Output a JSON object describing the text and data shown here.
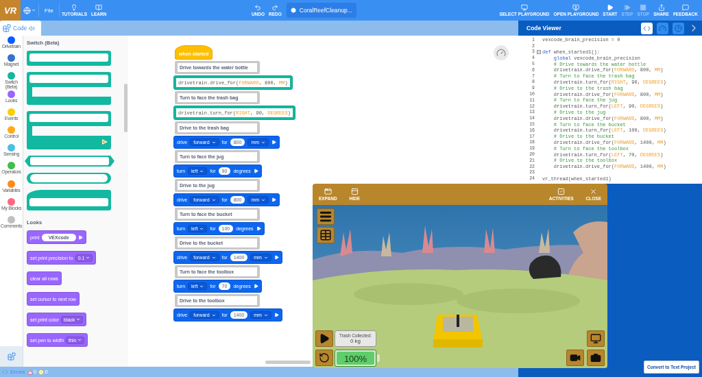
{
  "top_bar": {
    "logo": "VR",
    "menus": [
      {
        "label": "File"
      }
    ],
    "tools": [
      {
        "label": "TUTORIALS"
      },
      {
        "label": "LEARN"
      }
    ],
    "history": [
      {
        "label": "UNDO"
      },
      {
        "label": "REDO"
      }
    ],
    "project": "CoralReefCleanup...",
    "actions": [
      {
        "label": "SELECT PLAYGROUND",
        "disabled": false
      },
      {
        "label": "OPEN PLAYGROUND",
        "disabled": false
      },
      {
        "label": "START",
        "disabled": false
      },
      {
        "label": "STEP",
        "disabled": true
      },
      {
        "label": "STOP",
        "disabled": true
      },
      {
        "label": "SHARE",
        "disabled": false
      },
      {
        "label": "FEEDBACK",
        "disabled": false
      }
    ]
  },
  "code_tab": {
    "label": "Code",
    "selected": true
  },
  "categories": [
    {
      "label": "Drivetrain",
      "color": "#0a5cff"
    },
    {
      "label": "Magnet",
      "color": "#3373cc"
    },
    {
      "label": "Switch (Beta)",
      "color": "#13b8a0"
    },
    {
      "label": "Looks",
      "color": "#9966ff"
    },
    {
      "label": "Events",
      "color": "#ffcc00"
    },
    {
      "label": "Control",
      "color": "#ffab19"
    },
    {
      "label": "Sensing",
      "color": "#4cbfe6"
    },
    {
      "label": "Operators",
      "color": "#40bf4a"
    },
    {
      "label": "Variables",
      "color": "#ff8c1a"
    },
    {
      "label": "My Blocks",
      "color": "#ff6680"
    },
    {
      "label": "Comments",
      "color": "#c0c0c0"
    }
  ],
  "palette": {
    "sections": [
      {
        "title": "Switch (Beta)",
        "blocks": [
          {
            "kind": "stack"
          },
          {
            "kind": "c"
          },
          {
            "kind": "c-arrow"
          },
          {
            "kind": "hex"
          },
          {
            "kind": "round"
          },
          {
            "kind": "hat"
          }
        ]
      },
      {
        "title": "Looks",
        "blocks": [
          {
            "kind": "input",
            "label": "print",
            "value": "VEXcode"
          },
          {
            "kind": "dropdown",
            "label": "set print precision to",
            "value": "0.1"
          },
          {
            "kind": "plain",
            "label": "clear all rows"
          },
          {
            "kind": "plain",
            "label": "set cursor to next row"
          },
          {
            "kind": "dropdown",
            "label": "set print color",
            "value": "black"
          },
          {
            "kind": "dropdown",
            "label": "set pen to width",
            "value": "thin"
          }
        ]
      }
    ]
  },
  "script": {
    "hat": "when started",
    "steps": [
      {
        "kind": "comment",
        "text": "Drive towards the water bottle"
      },
      {
        "kind": "python",
        "code": [
          {
            "kind": "plain",
            "text": "drivetrain.drive_for("
          },
          {
            "kind": "const",
            "text": "FORWARD"
          },
          {
            "kind": "plain",
            "text": ", 800, "
          },
          {
            "kind": "const",
            "text": "MM"
          },
          {
            "kind": "plain",
            "text": ")"
          }
        ]
      },
      {
        "kind": "comment",
        "text": "Turn to face the trash bag"
      },
      {
        "kind": "python",
        "code": [
          {
            "kind": "plain",
            "text": "drivetrain.turn_for("
          },
          {
            "kind": "const",
            "text": "RIGHT"
          },
          {
            "kind": "plain",
            "text": ", 90, "
          },
          {
            "kind": "const",
            "text": "DEGREES"
          },
          {
            "kind": "plain",
            "text": ")"
          }
        ]
      },
      {
        "kind": "comment",
        "text": "Drive to the trash bag"
      },
      {
        "kind": "drive",
        "verb": "drive",
        "direction": "forward",
        "for": "for",
        "amount": "800",
        "unit": "mm"
      },
      {
        "kind": "comment",
        "text": "Turn to face the jug"
      },
      {
        "kind": "turn",
        "verb": "turn",
        "direction": "left",
        "for": "for",
        "amount": "90",
        "unit": "degrees"
      },
      {
        "kind": "comment",
        "text": "Drive to the jug"
      },
      {
        "kind": "drive",
        "verb": "drive",
        "direction": "forward",
        "for": "for",
        "amount": "800",
        "unit": "mm"
      },
      {
        "kind": "comment",
        "text": "Turn to face the bucket"
      },
      {
        "kind": "turn",
        "verb": "turn",
        "direction": "left",
        "for": "for",
        "amount": "100",
        "unit": "degrees"
      },
      {
        "kind": "comment",
        "text": "Drive to the bucket"
      },
      {
        "kind": "drive",
        "verb": "drive",
        "direction": "forward",
        "for": "for",
        "amount": "1400",
        "unit": "mm"
      },
      {
        "kind": "comment",
        "text": "Turn to face the toolbox"
      },
      {
        "kind": "turn",
        "verb": "turn",
        "direction": "left",
        "for": "for",
        "amount": "70",
        "unit": "degrees"
      },
      {
        "kind": "comment",
        "text": "Drive to the toolbox"
      },
      {
        "kind": "drive",
        "verb": "drive",
        "direction": "forward",
        "for": "for",
        "amount": "1400",
        "unit": "mm"
      }
    ]
  },
  "code_viewer": {
    "title": "Code Viewer",
    "view_buttons": [
      {
        "selected": true
      },
      {
        "selected": false
      },
      {
        "selected": false
      }
    ],
    "lines": [
      {
        "n": "1",
        "code": [
          {
            "kind": "plain",
            "text": "vexcode_brain_precision = 0"
          }
        ]
      },
      {
        "n": "2"
      },
      {
        "n": "3",
        "foldable": true,
        "code": [
          {
            "kind": "keyword",
            "text": "def"
          },
          {
            "kind": "plain",
            "text": " when_started1():"
          }
        ]
      },
      {
        "n": "4",
        "code": [
          {
            "kind": "keyword",
            "text": "    global"
          },
          {
            "kind": "plain",
            "text": " vexcode_brain_precision"
          }
        ]
      },
      {
        "n": "5",
        "code": [
          {
            "kind": "comment",
            "text": "    # Drive towards the water bottle"
          }
        ]
      },
      {
        "n": "6",
        "code": [
          {
            "kind": "plain",
            "text": "    drivetrain.drive_for("
          },
          {
            "kind": "const",
            "text": "FORWARD"
          },
          {
            "kind": "plain",
            "text": ", 800, "
          },
          {
            "kind": "const",
            "text": "MM"
          },
          {
            "kind": "plain",
            "text": ")"
          }
        ]
      },
      {
        "n": "7",
        "code": [
          {
            "kind": "comment",
            "text": "    # Turn to face the trash bag"
          }
        ]
      },
      {
        "n": "8",
        "code": [
          {
            "kind": "plain",
            "text": "    drivetrain.turn_for("
          },
          {
            "kind": "const",
            "text": "RIGHT"
          },
          {
            "kind": "plain",
            "text": ", 90, "
          },
          {
            "kind": "const",
            "text": "DEGREES"
          },
          {
            "kind": "plain",
            "text": ")"
          }
        ]
      },
      {
        "n": "9",
        "code": [
          {
            "kind": "comment",
            "text": "    # Drive to the trash bag"
          }
        ]
      },
      {
        "n": "10",
        "code": [
          {
            "kind": "plain",
            "text": "    drivetrain.drive_for("
          },
          {
            "kind": "const",
            "text": "FORWARD"
          },
          {
            "kind": "plain",
            "text": ", 800, "
          },
          {
            "kind": "const",
            "text": "MM"
          },
          {
            "kind": "plain",
            "text": ")"
          }
        ]
      },
      {
        "n": "11",
        "code": [
          {
            "kind": "comment",
            "text": "    # Turn to face the jug"
          }
        ]
      },
      {
        "n": "12",
        "code": [
          {
            "kind": "plain",
            "text": "    drivetrain.turn_for("
          },
          {
            "kind": "const",
            "text": "LEFT"
          },
          {
            "kind": "plain",
            "text": ", 90, "
          },
          {
            "kind": "const",
            "text": "DEGREES"
          },
          {
            "kind": "plain",
            "text": ")"
          }
        ]
      },
      {
        "n": "13",
        "code": [
          {
            "kind": "comment",
            "text": "    # Drive to the jug"
          }
        ]
      },
      {
        "n": "14",
        "code": [
          {
            "kind": "plain",
            "text": "    drivetrain.drive_for("
          },
          {
            "kind": "const",
            "text": "FORWARD"
          },
          {
            "kind": "plain",
            "text": ", 800, "
          },
          {
            "kind": "const",
            "text": "MM"
          },
          {
            "kind": "plain",
            "text": ")"
          }
        ]
      },
      {
        "n": "15",
        "code": [
          {
            "kind": "comment",
            "text": "    # Turn to face the bucket"
          }
        ]
      },
      {
        "n": "16",
        "code": [
          {
            "kind": "plain",
            "text": "    drivetrain.turn_for("
          },
          {
            "kind": "const",
            "text": "LEFT"
          },
          {
            "kind": "plain",
            "text": ", 100, "
          },
          {
            "kind": "const",
            "text": "DEGREES"
          },
          {
            "kind": "plain",
            "text": ")"
          }
        ]
      },
      {
        "n": "17",
        "code": [
          {
            "kind": "comment",
            "text": "    # Drive to the bucket"
          }
        ]
      },
      {
        "n": "18",
        "code": [
          {
            "kind": "plain",
            "text": "    drivetrain.drive_for("
          },
          {
            "kind": "const",
            "text": "FORWARD"
          },
          {
            "kind": "plain",
            "text": ", 1400, "
          },
          {
            "kind": "const",
            "text": "MM"
          },
          {
            "kind": "plain",
            "text": ")"
          }
        ]
      },
      {
        "n": "19",
        "code": [
          {
            "kind": "comment",
            "text": "    # Turn to face the toolbox"
          }
        ]
      },
      {
        "n": "20",
        "code": [
          {
            "kind": "plain",
            "text": "    drivetrain.turn_for("
          },
          {
            "kind": "const",
            "text": "LEFT"
          },
          {
            "kind": "plain",
            "text": ", 70, "
          },
          {
            "kind": "const",
            "text": "DEGREES"
          },
          {
            "kind": "plain",
            "text": ")"
          }
        ]
      },
      {
        "n": "21",
        "code": [
          {
            "kind": "comment",
            "text": "    # Drive to the toolbox"
          }
        ]
      },
      {
        "n": "22",
        "code": [
          {
            "kind": "plain",
            "text": "    drivetrain.drive_for("
          },
          {
            "kind": "const",
            "text": "FORWARD"
          },
          {
            "kind": "plain",
            "text": ", 1400, "
          },
          {
            "kind": "const",
            "text": "MM"
          },
          {
            "kind": "plain",
            "text": ")"
          }
        ]
      },
      {
        "n": "23"
      },
      {
        "n": "24",
        "code": [
          {
            "kind": "plain",
            "text": "vr_thread(when_started1)"
          }
        ]
      }
    ],
    "convert_button": "Convert to Text Project"
  },
  "playground": {
    "left_tools": [
      {
        "label": "EXPAND"
      },
      {
        "label": "HIDE"
      }
    ],
    "right_tools": [
      {
        "label": "ACTIVITIES"
      },
      {
        "label": "CLOSE"
      }
    ],
    "trash": {
      "label": "Trash Collected:",
      "value": "0 kg"
    },
    "battery": {
      "level": 1,
      "reading": "100%"
    }
  },
  "errors_bar": {
    "label": "Errors",
    "warnings": "0",
    "errors": "0"
  }
}
